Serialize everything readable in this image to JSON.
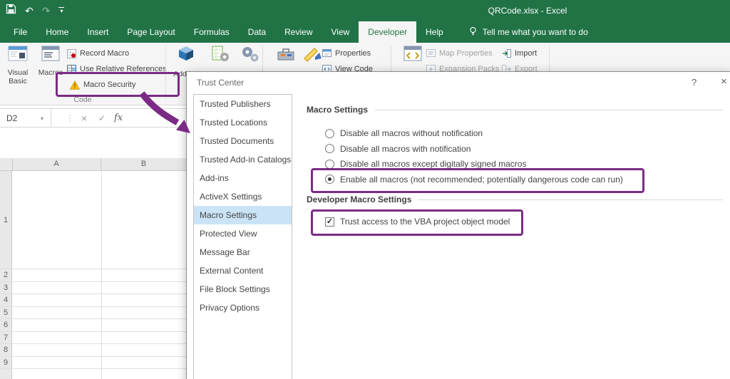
{
  "titlebar": {
    "title": "QRCode.xlsx - Excel",
    "undo_glyph": "↶",
    "redo_glyph": "↷",
    "caret_glyph": "▾"
  },
  "ribbon": {
    "tabs": [
      {
        "label": "File"
      },
      {
        "label": "Home"
      },
      {
        "label": "Insert"
      },
      {
        "label": "Page Layout"
      },
      {
        "label": "Formulas"
      },
      {
        "label": "Data"
      },
      {
        "label": "Review"
      },
      {
        "label": "View"
      },
      {
        "label": "Developer",
        "active": true
      },
      {
        "label": "Help"
      }
    ],
    "tell_me": "Tell me what you want to do",
    "code_group": {
      "visual_basic": "Visual Basic",
      "macros": "Macros",
      "record_macro": "Record Macro",
      "use_relative_references": "Use Relative References",
      "macro_security": "Macro Security",
      "label": "Code"
    },
    "addins_group": {
      "addins": "Add-ins"
    },
    "controls_group": {
      "properties": "Properties",
      "view_code": "View Code"
    },
    "xml_group": {
      "map_properties": "Map Properties",
      "expansion_packs": "Expansion Packs",
      "import": "Import",
      "export": "Export"
    }
  },
  "formula_bar": {
    "name_box": "D2",
    "caret": "▾",
    "dots": "⋮",
    "cancel": "×",
    "enter": "✓",
    "fx": "fx"
  },
  "grid": {
    "columns": [
      "A",
      "B"
    ],
    "rows": [
      "1",
      "2",
      "3",
      "4",
      "5",
      "6",
      "7",
      "8",
      "9"
    ]
  },
  "dialog": {
    "title": "Trust Center",
    "help_glyph": "?",
    "close_glyph": "×",
    "sidebar": [
      {
        "label": "Trusted Publishers"
      },
      {
        "label": "Trusted Locations"
      },
      {
        "label": "Trusted Documents"
      },
      {
        "label": "Trusted Add-in Catalogs"
      },
      {
        "label": "Add-ins"
      },
      {
        "label": "ActiveX Settings"
      },
      {
        "label": "Macro Settings",
        "selected": true
      },
      {
        "label": "Protected View"
      },
      {
        "label": "Message Bar"
      },
      {
        "label": "External Content"
      },
      {
        "label": "File Block Settings"
      },
      {
        "label": "Privacy Options"
      }
    ],
    "macro_settings": {
      "heading": "Macro Settings",
      "options": [
        {
          "label": "Disable all macros without notification",
          "selected": false
        },
        {
          "label": "Disable all macros with notification",
          "selected": false
        },
        {
          "label": "Disable all macros except digitally signed macros",
          "selected": false
        },
        {
          "label": "Enable all macros (not recommended; potentially dangerous code can run)",
          "selected": true
        }
      ]
    },
    "developer_macro_settings": {
      "heading": "Developer Macro Settings",
      "checkbox_label": "Trust access to the VBA project object model",
      "checkbox_checked": true,
      "check_glyph": "✓"
    }
  },
  "colors": {
    "excel_green": "#217346",
    "annotation_purple": "#7b2b85",
    "sidebar_selection": "#cbe3f6"
  }
}
